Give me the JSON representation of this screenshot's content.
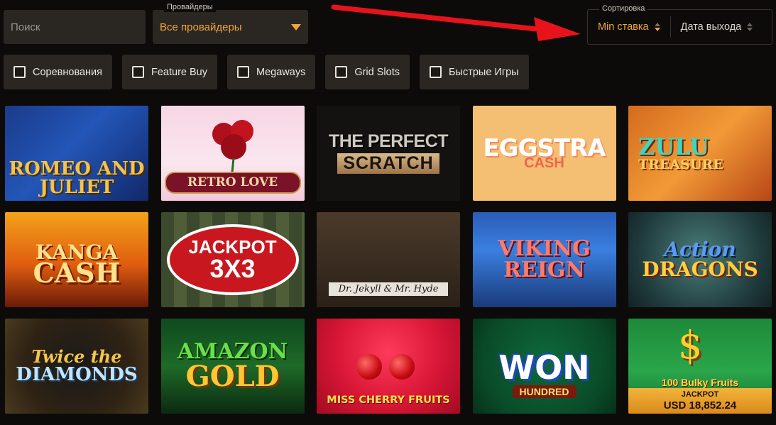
{
  "search": {
    "placeholder": "Поиск",
    "icon": "search-icon"
  },
  "providers": {
    "label": "Провайдеры",
    "value": "Все провайдеры"
  },
  "sort": {
    "label": "Сортировка",
    "options": [
      {
        "label": "Min ставка",
        "active": true
      },
      {
        "label": "Дата выхода",
        "active": false
      }
    ]
  },
  "filters": [
    {
      "label": "Соревнования"
    },
    {
      "label": "Feature Buy"
    },
    {
      "label": "Megaways"
    },
    {
      "label": "Grid Slots"
    },
    {
      "label": "Быстрые Игры"
    }
  ],
  "games": {
    "romeo": {
      "title": "Romeo and Juliet"
    },
    "retro": {
      "title": "Retro Love"
    },
    "scratch": {
      "line1": "The Perfect",
      "line2": "Scratch"
    },
    "eggs": {
      "line1": "Eggstra",
      "line2": "Cash"
    },
    "zulu": {
      "line1": "Zulu",
      "line2": "Treasure"
    },
    "kanga": {
      "line1": "Kanga",
      "line2": "Cash"
    },
    "jackpot": {
      "line1": "Jackpot",
      "line2": "3x3"
    },
    "jekyll": {
      "title": "Dr. Jekyll & Mr. Hyde"
    },
    "viking": {
      "line1": "Viking",
      "line2": "Reign"
    },
    "action": {
      "line1": "Action",
      "line2": "Dragons"
    },
    "twice": {
      "line1": "Twice the",
      "line2": "Diamonds"
    },
    "amazon": {
      "line1": "Amazon",
      "line2": "Gold"
    },
    "cherry": {
      "title": "Miss Cherry Fruits"
    },
    "won": {
      "line1": "Won",
      "line2": "Hundred"
    },
    "bulky": {
      "header": "100 Bulky Fruits",
      "jackpot_label": "JACKPOT",
      "jackpot_value": "USD 18,852.24"
    }
  },
  "colors": {
    "accent": "#f0a53a",
    "panel": "#2a2622",
    "background": "#0d0b09",
    "annotation_arrow": "#e8131a"
  }
}
